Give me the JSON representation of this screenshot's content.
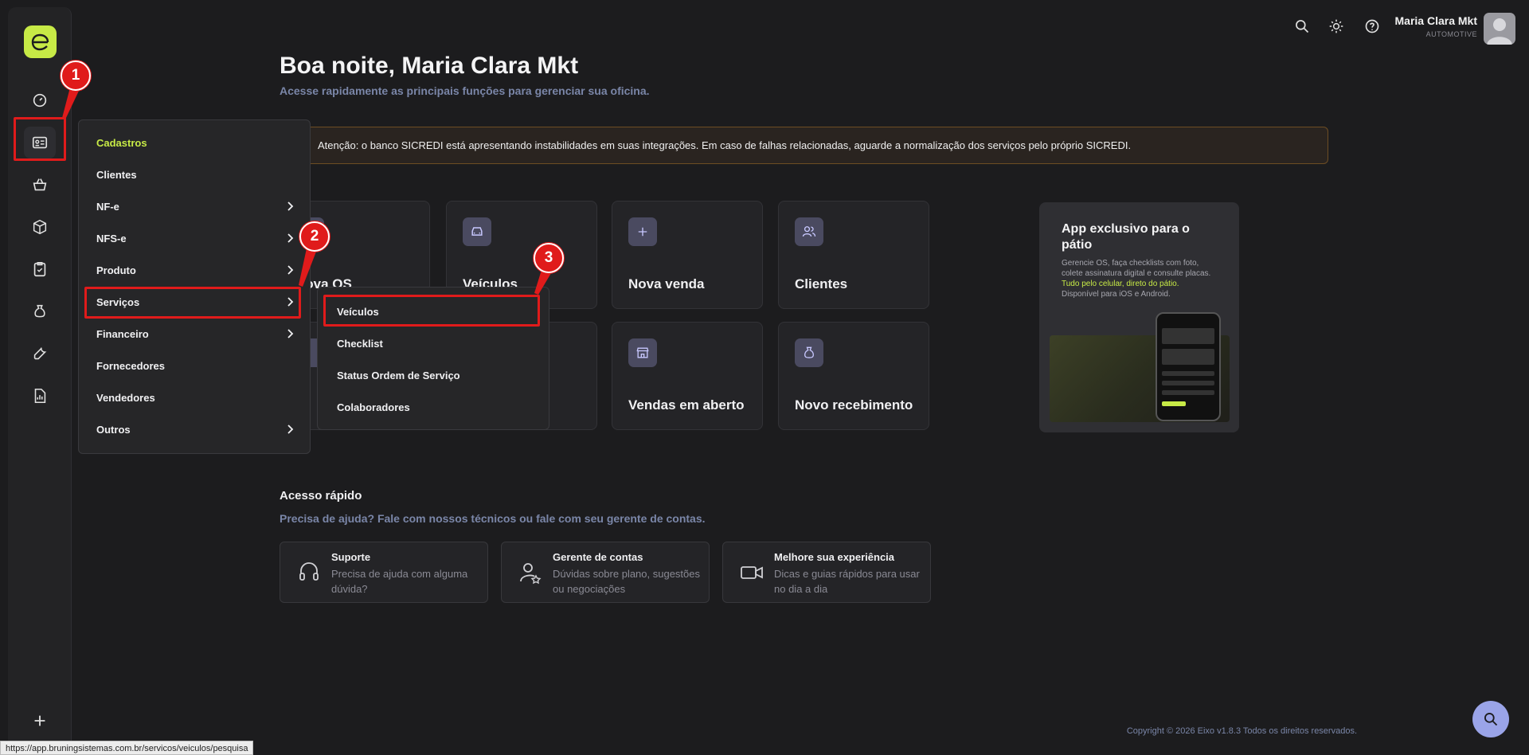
{
  "header": {
    "user_name": "Maria Clara Mkt",
    "user_role": "AUTOMOTIVE"
  },
  "greeting": {
    "title": "Boa noite, Maria Clara Mkt",
    "subtitle": "Acesse rapidamente as principais funções para gerenciar sua oficina."
  },
  "alert": {
    "text": "Atenção: o banco SICREDI está apresentando instabilidades em suas integrações. Em caso de falhas relacionadas, aguarde a normalização dos serviços pelo próprio SICREDI."
  },
  "cards": [
    {
      "label": "Nova OS",
      "icon": "document-icon"
    },
    {
      "label": "Veículos",
      "icon": "car-icon"
    },
    {
      "label": "Nova venda",
      "icon": "plus-icon"
    },
    {
      "label": "Clientes",
      "icon": "users-icon"
    },
    {
      "label": "",
      "icon": "tool-icon"
    },
    {
      "label": "",
      "icon": "box-icon"
    },
    {
      "label": "Vendas em aberto",
      "icon": "store-icon"
    },
    {
      "label": "Novo recebimento",
      "icon": "money-bag-icon"
    }
  ],
  "promo": {
    "title": "App exclusivo para o pátio",
    "text_1": "Gerencie OS, faça checklists com foto, colete assinatura digital e consulte placas.",
    "text_highlight": "Tudo pelo celular, direto do pátio.",
    "text_2": "Disponível para iOS e Android."
  },
  "quick_access": {
    "title": "Acesso rápido",
    "subtitle": "Precisa de ajuda? Fale com nossos técnicos ou fale com seu gerente de contas.",
    "items": [
      {
        "title": "Suporte",
        "desc": "Precisa de ajuda com alguma dúvida?"
      },
      {
        "title": "Gerente de contas",
        "desc": "Dúvidas sobre plano, sugestões ou negociações"
      },
      {
        "title": "Melhore sua experiência",
        "desc": "Dicas e guias rápidos para usar no dia a dia"
      }
    ]
  },
  "menu": {
    "items": [
      {
        "label": "Cadastros"
      },
      {
        "label": "Clientes"
      },
      {
        "label": "NF-e"
      },
      {
        "label": "NFS-e"
      },
      {
        "label": "Produto"
      },
      {
        "label": "Serviços"
      },
      {
        "label": "Financeiro"
      },
      {
        "label": "Fornecedores"
      },
      {
        "label": "Vendedores"
      },
      {
        "label": "Outros"
      }
    ],
    "submenu": [
      {
        "label": "Veículos"
      },
      {
        "label": "Checklist"
      },
      {
        "label": "Status Ordem de Serviço"
      },
      {
        "label": "Colaboradores"
      }
    ]
  },
  "markers": [
    "1",
    "2",
    "3"
  ],
  "footer": {
    "copyright": "Copyright © 2026 Eixo v1.8.3 Todos os direitos reservados."
  },
  "status_url": "https://app.bruningsistemas.com.br/servicos/veiculos/pesquisa",
  "colors": {
    "accent": "#c7ea46",
    "highlight": "#e01b1b",
    "background": "#1c1c1e"
  }
}
